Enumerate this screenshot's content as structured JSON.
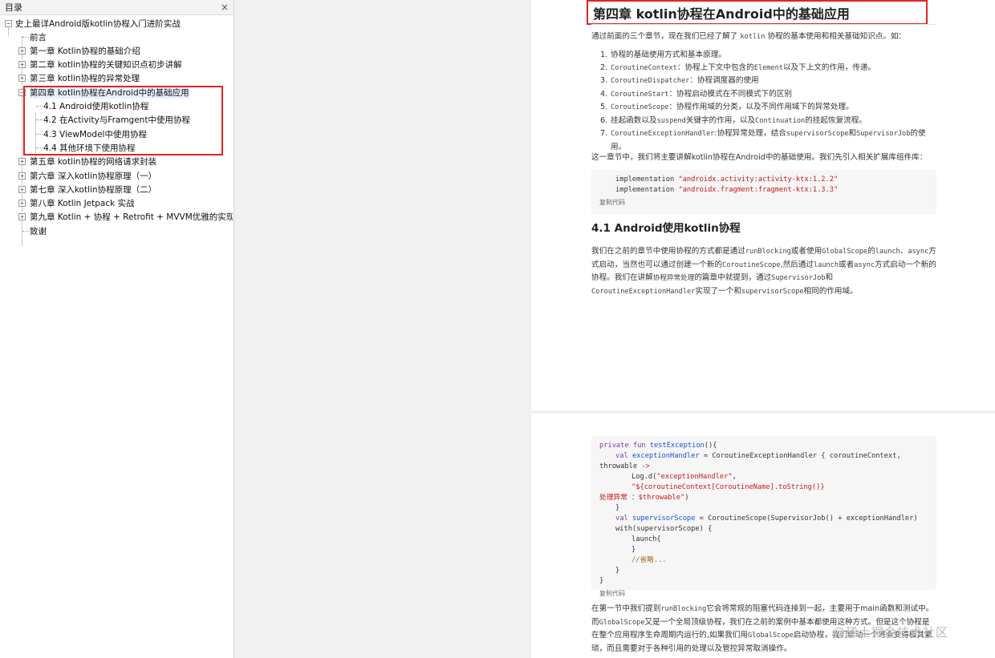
{
  "sidebar": {
    "title": "目录",
    "close": "×",
    "root": "史上最详Android版kotlin协程入门进阶实战",
    "items": [
      {
        "label": "前言",
        "expandable": false
      },
      {
        "label": "第一章 Kotlin协程的基础介绍",
        "expandable": true
      },
      {
        "label": "第二章 kotlin协程的关键知识点初步讲解",
        "expandable": true
      },
      {
        "label": "第三章 kotlin协程的异常处理",
        "expandable": true
      },
      {
        "label": "第四章 kotlin协程在Android中的基础应用",
        "expandable": true,
        "expanded": true,
        "selected": true
      },
      {
        "label": "4.1 Android使用kotlin协程",
        "child": true
      },
      {
        "label": "4.2 在Activity与Framgent中使用协程",
        "child": true
      },
      {
        "label": "4.3 ViewModel中使用协程",
        "child": true
      },
      {
        "label": "4.4 其他环境下使用协程",
        "child": true
      },
      {
        "label": "第五章 kotlin协程的网络请求封装",
        "expandable": true
      },
      {
        "label": "第六章 深入kotlin协程原理（一）",
        "expandable": true
      },
      {
        "label": "第七章 深入kotlin协程原理（二）",
        "expandable": true
      },
      {
        "label": "第八章 Kotlin Jetpack 实战",
        "expandable": true
      },
      {
        "label": "第九章 Kotlin + 协程 + Retrofit + MVVM优雅的实现网络请求",
        "expandable": true
      },
      {
        "label": "致谢",
        "expandable": false
      }
    ]
  },
  "page1": {
    "chapter_title": "第四章 kotlin协程在Android中的基础应用",
    "intro_a": "通过前面的三个章节，现在我们已经了解了",
    "intro_code": "kotlin",
    "intro_b": "协程的基本使用和相关基础知识点。如：",
    "points": [
      {
        "n": "1.",
        "code": "",
        "text": "协程的基础使用方式和基本原理。",
        "code2": "",
        "text2": ""
      },
      {
        "n": "2.",
        "code": "CoroutineContext",
        "text": "：协程上下文中包含的",
        "code2": "Element",
        "text2": "以及下上文的作用，传递。"
      },
      {
        "n": "3.",
        "code": "CoroutineDispatcher",
        "text": "：协程调度器的使用",
        "code2": "",
        "text2": ""
      },
      {
        "n": "4.",
        "code": "CoroutineStart",
        "text": "：协程启动模式在不同模式下的区别",
        "code2": "",
        "text2": ""
      },
      {
        "n": "5.",
        "code": "CoroutineScope",
        "text": "：协程作用域的分类，以及不同作用域下的异常处理。",
        "code2": "",
        "text2": ""
      },
      {
        "n": "6.",
        "code": "",
        "text": "挂起函数以及",
        "code2": "suspend",
        "text2": "关键字的作用，以及",
        "code3": "Continuation",
        "text3": "的挂起恢复流程。"
      },
      {
        "n": "7.",
        "code": "CoroutineExceptionHandler",
        "text": ":协程异常处理，结合",
        "code2": "supervisorScope",
        "text2": "和",
        "code3": "SupervisorJob",
        "text3": "的使用。"
      }
    ],
    "lead": "这一章节中，我们将主要讲解kotlin协程在Android中的基础使用。我们先引入相关扩展库组件库：",
    "deps": [
      {
        "kw": "implementation",
        "str": "\"androidx.activity:activity-ktx:1.2.2\""
      },
      {
        "kw": "implementation",
        "str": "\"androidx.fragment:fragment-ktx:1.3.3\""
      }
    ],
    "copy_label": "复制代码",
    "section_title": "4.1 Android使用kotlin协程",
    "para": {
      "a": "我们在之前的章节中使用协程的方式都是通过",
      "c1": "runBlocking",
      "b": "或者使用",
      "c2": "GlobalScope",
      "c": "的",
      "c3": "launch",
      "d": "、",
      "c4": "async",
      "e": "方式启动，当然也可以通过创建一个新的",
      "c5": "CoroutineScope",
      "f": ",然后通过",
      "c6": "launch",
      "g": "或者",
      "c7": "async",
      "h": "方式启动一个新的协程。我们在讲解",
      "c8": "协程异常处理",
      "i": "的篇章中就提到，通过",
      "c9": "SupervisorJob",
      "j": "和",
      "c10": "CoroutineExceptionHandler",
      "k": "实现了一个和",
      "c11": "supervisorScope",
      "l": "相同的作用域。"
    }
  },
  "page2": {
    "code_lines": {
      "l1_kw": "private fun",
      "l1_fn": "testException",
      "l1_rest": "(){",
      "l2_kw": "val",
      "l2_fn": "exceptionHandler",
      "l2_rest": "= CoroutineExceptionHandler { coroutineContext,",
      "l3": "throwable",
      "l3_arrow": "->",
      "l4_pre": "Log.d(",
      "l4_str1": "\"exceptionHandler\"",
      "l4_mid": ", ",
      "l4_str2": "\"${coroutineContext[CoroutineName].toString()}",
      "l5_str": "处理异常 ：$throwable\"",
      "l5_rest": ")",
      "l6": "}",
      "l7_kw": "val",
      "l7_fn": "supervisorScope",
      "l7_rest": "= CoroutineScope(SupervisorJob() + exceptionHandler)",
      "l8": "with(supervisorScope) {",
      "l9": "launch{",
      "l10": "}",
      "l11": "//省略...",
      "l12": "}",
      "l13": "}"
    },
    "copy_label": "复制代码",
    "para": {
      "a": "在第一节中我们提到",
      "c1": "runBlocking",
      "b": "它会将常规的阻塞代码连接到一起，主要用于main函数和测试中。而",
      "c2": "GlobalScope",
      "c": "又是一个全局顶级协程，我们在之前的案例中基本都使用这种方式。但是这个协程是在整个应用程序生命周期内运行的,如果我们用",
      "c3": "GlobalScope",
      "d": "启动协程，我们启动一个将会变得极其繁琐，而且需要对于各种引用的处理以及管控异常取消操作。"
    }
  },
  "watermark": "@稀土掘金技术社区"
}
